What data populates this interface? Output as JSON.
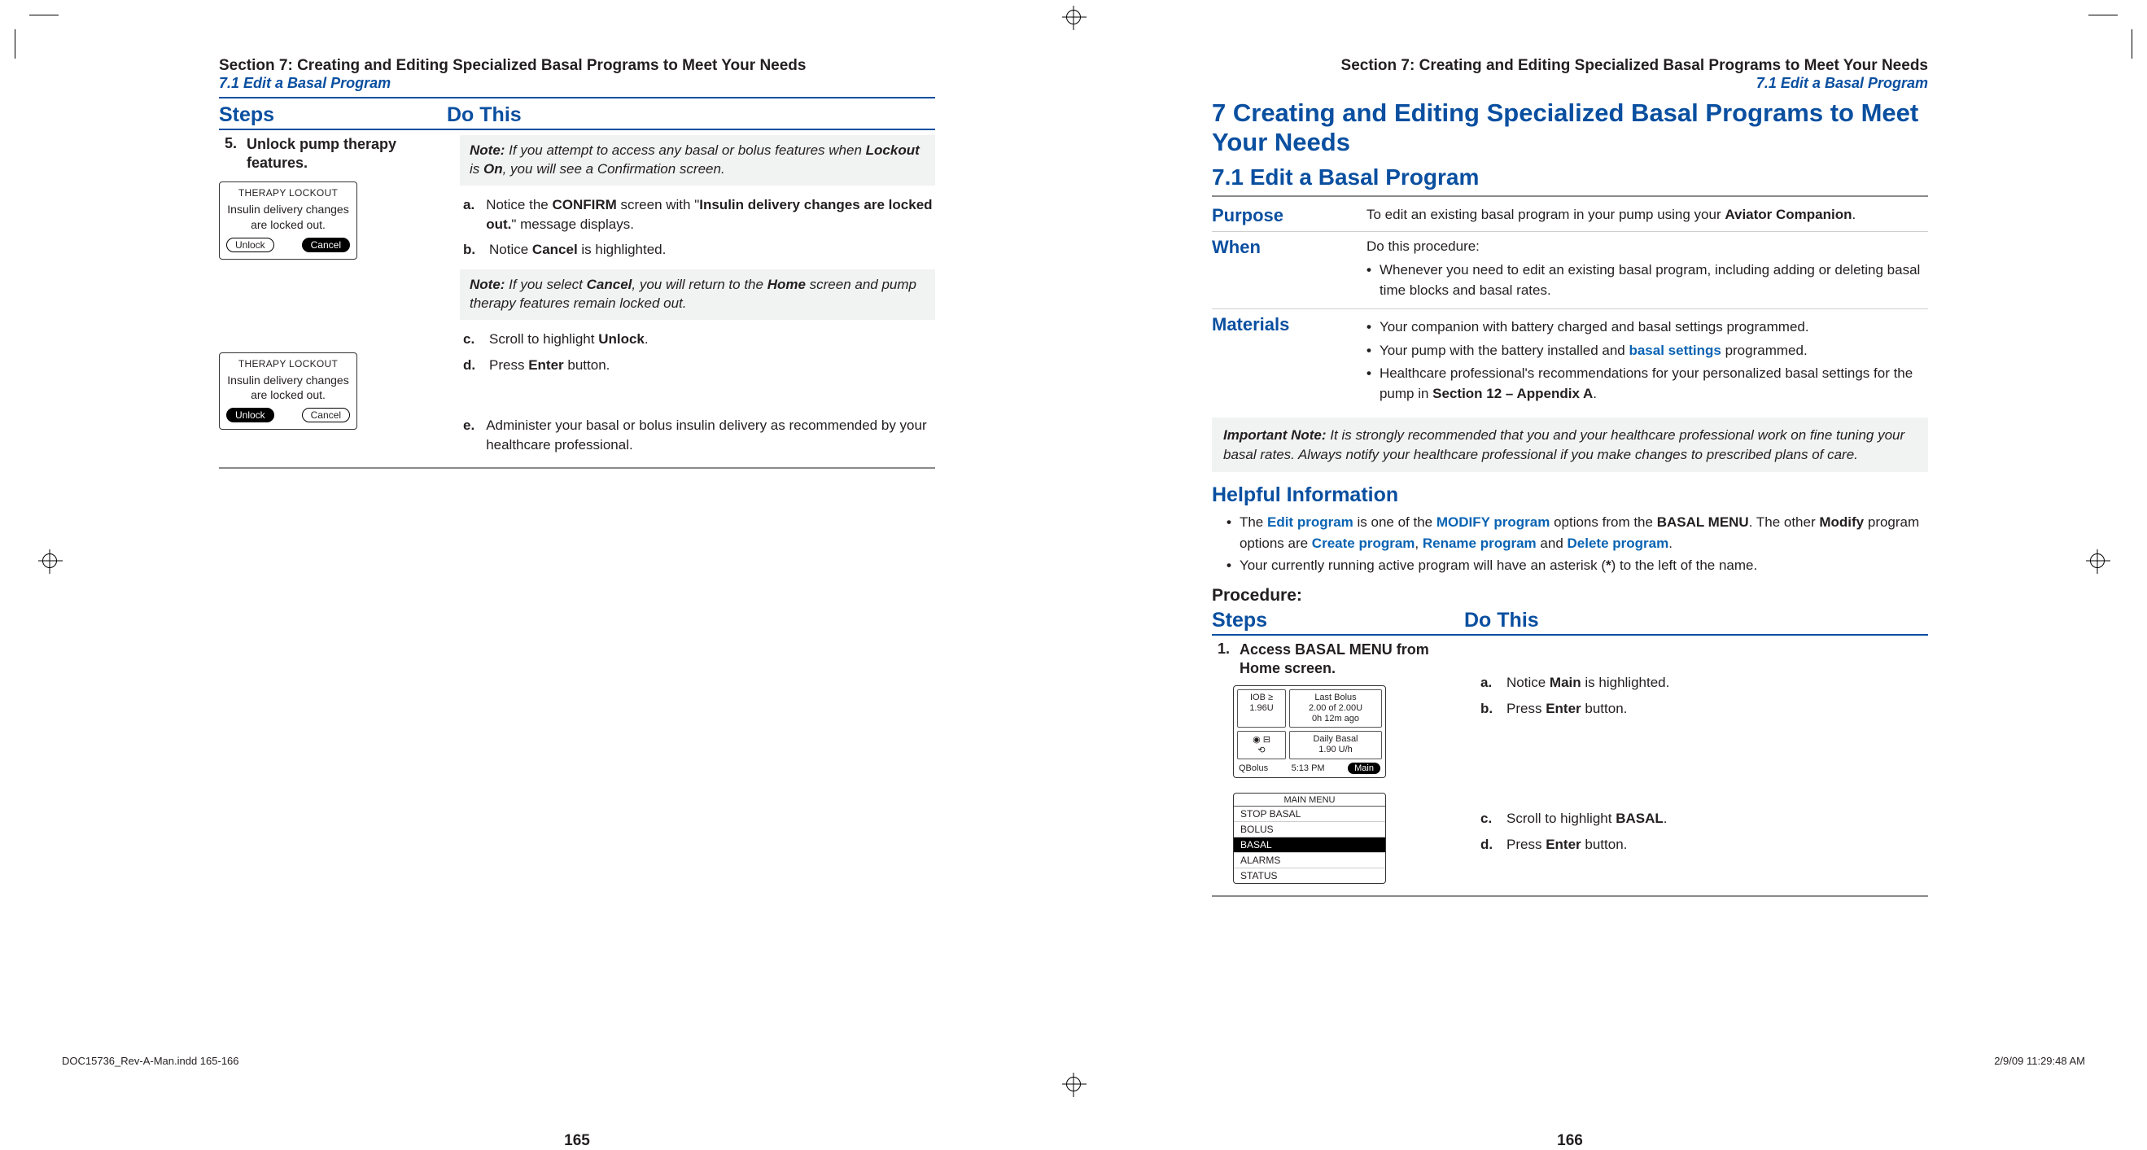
{
  "left": {
    "section_header": "Section 7: Creating and Editing Specialized Basal Programs to Meet Your Needs",
    "sub": "7.1 Edit a Basal Program",
    "steps_header": "Steps",
    "dothis_header": "Do This",
    "step_num": "5.",
    "step_title": "Unlock pump therapy features.",
    "note1_label": "Note:",
    "note1_text_a": " If you attempt to access any basal or bolus features when ",
    "note1_lockout": "Lockout",
    "note1_text_b": " is ",
    "note1_on": "On",
    "note1_text_c": ", you will see a Confirmation screen.",
    "a_m": "a.",
    "a_pre": "Notice the ",
    "a_confirm": "CONFIRM",
    "a_mid": " screen with \"",
    "a_msg": "Insulin delivery changes are locked out.",
    "a_post": "\" message displays.",
    "b_m": "b.",
    "b_pre": "Notice ",
    "b_cancel": "Cancel",
    "b_post": " is highlighted.",
    "note2_label": "Note:",
    "note2_a": " If you select ",
    "note2_cancel": "Cancel",
    "note2_b": ", you will return to the ",
    "note2_home": "Home",
    "note2_c": " screen and pump therapy features remain locked out.",
    "c_m": "c.",
    "c_pre": "Scroll to highlight ",
    "c_unlock": "Unlock",
    "c_post": ".",
    "d_m": "d.",
    "d_pre": "Press ",
    "d_enter": "Enter",
    "d_post": " button.",
    "e_m": "e.",
    "e_text": "Administer your basal or bolus insulin delivery as recommended by your healthcare professional.",
    "dev_title": "THERAPY LOCKOUT",
    "dev_body": "Insulin delivery changes are locked out.",
    "btn_unlock": "Unlock",
    "btn_cancel": "Cancel",
    "page_num": "165"
  },
  "right": {
    "section_header": "Section 7: Creating and Editing Specialized Basal Programs to Meet Your Needs",
    "sub": "7.1 Edit a Basal Program",
    "chapter_num": "7",
    "chapter_title": "  Creating and Editing Specialized Basal Programs to Meet Your Needs",
    "h71": "7.1  Edit a Basal Program",
    "purpose_label": "Purpose",
    "purpose_pre": "To edit an existing basal program in your pump using your ",
    "purpose_av": "Aviator Companion",
    "purpose_post": ".",
    "when_label": "When",
    "when_intro": "Do this procedure:",
    "when_b1": "Whenever you need to edit an existing basal program, including adding or deleting basal time blocks and basal rates.",
    "materials_label": "Materials",
    "mat_b1": "Your companion with battery charged and basal settings programmed.",
    "mat_b2_pre": "Your pump with the battery installed and ",
    "mat_b2_link": "basal settings",
    "mat_b2_post": " programmed.",
    "mat_b3_pre": "Healthcare professional's recommendations for your personalized basal settings for the pump in ",
    "mat_b3_sect": "Section 12 – Appendix A",
    "mat_b3_post": ".",
    "impnote_label": "Important Note:",
    "impnote_text": " It is strongly recommended that you and your healthcare professional work on fine tuning your basal rates. Always notify your healthcare professional if you make changes to prescribed plans of care.",
    "helpful": "Helpful Information",
    "hi1_pre": "The ",
    "hi1_edit": "Edit program",
    "hi1_mid1": " is one of the ",
    "hi1_modify": "MODIFY program",
    "hi1_mid2": " options from the ",
    "hi1_basalmenu": "BASAL MENU",
    "hi1_mid3": ". The other ",
    "hi1_modifyb": "Modify",
    "hi1_mid4": " program options are ",
    "hi1_create": "Create program",
    "hi1_c1": ", ",
    "hi1_rename": "Rename program",
    "hi1_c2": " and ",
    "hi1_delete": "Delete program",
    "hi1_end": ".",
    "hi2_pre": "Your currently running active program will have an asterisk (",
    "hi2_star": "*",
    "hi2_post": ") to the left of the name.",
    "procedure": "Procedure:",
    "steps_header": "Steps",
    "dothis_header": "Do This",
    "s1_num": "1.",
    "s1_title": "Access BASAL MENU from Home screen.",
    "s1a_m": "a.",
    "s1a_pre": "Notice ",
    "s1a_main": "Main",
    "s1a_post": " is highlighted.",
    "s1b_m": "b.",
    "s1b_pre": "Press ",
    "s1b_enter": "Enter",
    "s1b_post": " button.",
    "s1c_m": "c.",
    "s1c_pre": "Scroll to highlight ",
    "s1c_basal": "BASAL",
    "s1c_post": ".",
    "s1d_m": "d.",
    "s1d_pre": "Press ",
    "s1d_enter": "Enter",
    "s1d_post": " button.",
    "home_iob_lbl": "IOB ≥",
    "home_iob_val": "1.96U",
    "home_last_lbl": "Last Bolus",
    "home_last_v1": "2.00 of 2.00U",
    "home_last_v2": "0h 12m ago",
    "home_basal_lbl": "Daily Basal",
    "home_basal_v": "1.90 U/h",
    "home_qb": "QBolus",
    "home_time": "5:13 PM",
    "home_main": "Main",
    "menu_title": "MAIN MENU",
    "menu_i1": "STOP BASAL",
    "menu_i2": "BOLUS",
    "menu_i3": "BASAL",
    "menu_i4": "ALARMS",
    "menu_i5": "STATUS",
    "page_num": "166"
  },
  "imposition": {
    "file": "DOC15736_Rev-A-Man.indd   165-166",
    "stamp": "2/9/09   11:29:48 AM"
  }
}
